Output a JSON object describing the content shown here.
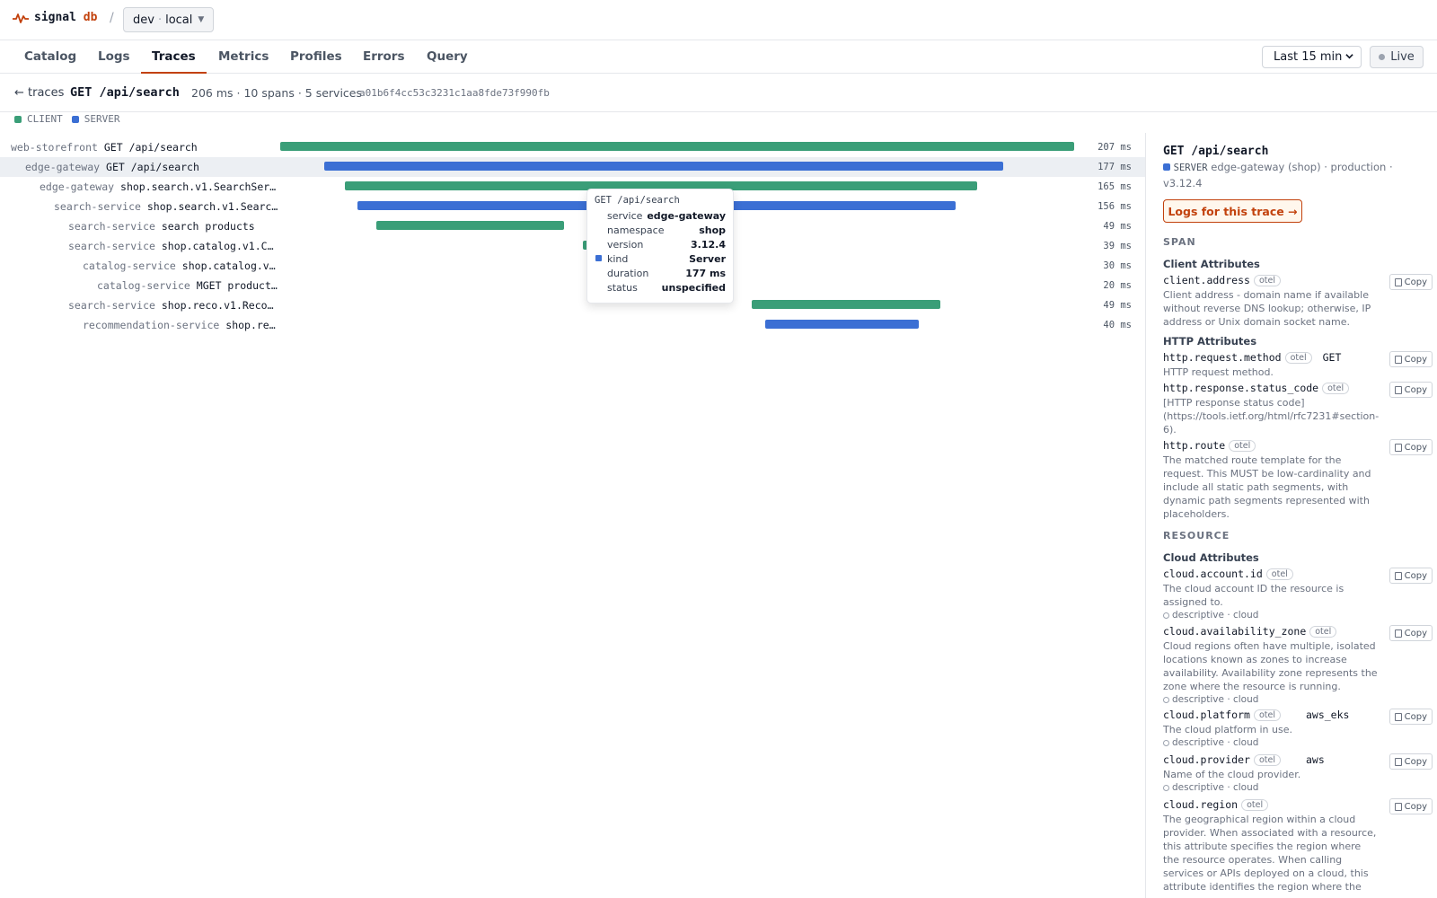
{
  "app": {
    "name": "signal",
    "name_accent": "db",
    "separator": "/",
    "env_name": "dev",
    "env_dot": "·",
    "env_location": "local"
  },
  "nav": {
    "tabs": [
      {
        "label": "Catalog"
      },
      {
        "label": "Logs"
      },
      {
        "label": "Traces",
        "active": true
      },
      {
        "label": "Metrics"
      },
      {
        "label": "Profiles"
      },
      {
        "label": "Errors"
      },
      {
        "label": "Query"
      }
    ],
    "time_range": "Last 15 min",
    "live_label": "Live"
  },
  "trace": {
    "back_label": "← traces",
    "title": "GET /api/search",
    "stats": "206 ms · 10 spans · 5 services",
    "trace_id": "a01b6f4cc53c3231c1aa8fde73f990fb"
  },
  "legend": [
    {
      "label": "CLIENT",
      "color": "#3a9e78"
    },
    {
      "label": "SERVER",
      "color": "#3b6fd4"
    }
  ],
  "spans": [
    {
      "service": "web-storefront",
      "operation": "GET /api/search",
      "duration": "207 ms",
      "kind": "client",
      "depth": 0,
      "start": 0,
      "end": 207
    },
    {
      "service": "edge-gateway",
      "operation": "GET /api/search",
      "duration": "177 ms",
      "kind": "server",
      "depth": 1,
      "start": 11.5,
      "end": 188.5,
      "selected": true
    },
    {
      "service": "edge-gateway",
      "operation": "shop.search.v1.SearchServi…",
      "duration": "165 ms",
      "kind": "client",
      "depth": 2,
      "start": 16.8,
      "end": 181.8
    },
    {
      "service": "search-service",
      "operation": "shop.search.v1.Search…",
      "duration": "156 ms",
      "kind": "server",
      "depth": 3,
      "start": 20.1,
      "end": 176.1
    },
    {
      "service": "search-service",
      "operation": "search products",
      "duration": "49 ms",
      "kind": "client",
      "depth": 4,
      "start": 25,
      "end": 74
    },
    {
      "service": "search-service",
      "operation": "shop.catalog.v1.Cat…",
      "duration": "39 ms",
      "kind": "client",
      "depth": 4,
      "start": 79,
      "end": 118
    },
    {
      "service": "catalog-service",
      "operation": "shop.catalog.v1.…",
      "duration": "30 ms",
      "kind": "server",
      "depth": 5,
      "start": 83,
      "end": 113
    },
    {
      "service": "catalog-service",
      "operation": "MGET product:…",
      "duration": "20 ms",
      "kind": "client",
      "depth": 6,
      "start": 88,
      "end": 108
    },
    {
      "service": "search-service",
      "operation": "shop.reco.v1.Recomm…",
      "duration": "49 ms",
      "kind": "client",
      "depth": 4,
      "start": 123,
      "end": 172
    },
    {
      "service": "recommendation-service",
      "operation": "shop.reco…",
      "duration": "40 ms",
      "kind": "server",
      "depth": 5,
      "start": 126.5,
      "end": 166.5
    }
  ],
  "tooltip": {
    "title": "GET /api/search",
    "rows": [
      {
        "key": "service",
        "value": "edge-gateway"
      },
      {
        "key": "namespace",
        "value": "shop"
      },
      {
        "key": "version",
        "value": "3.12.4"
      },
      {
        "key": "kind",
        "value": "Server",
        "swatch": true
      },
      {
        "key": "duration",
        "value": "177 ms"
      },
      {
        "key": "status",
        "value": "unspecified"
      }
    ]
  },
  "panel": {
    "title": "GET /api/search",
    "kind": "SERVER",
    "meta": "edge-gateway (shop) · production · v3.12.4",
    "logs_button": "Logs for this trace →",
    "span_section": "SPAN",
    "resource_section": "RESOURCE",
    "copy_label": "Copy",
    "otel_label": "otel",
    "groups": [
      {
        "title": "Client Attributes",
        "attrs": [
          {
            "name": "client.address",
            "value": "",
            "desc": "Client address - domain name if available without reverse DNS lookup; otherwise, IP address or Unix domain socket name."
          }
        ]
      },
      {
        "title": "HTTP Attributes",
        "attrs": [
          {
            "name": "http.request.method",
            "value": "GET",
            "desc": "HTTP request method."
          },
          {
            "name": "http.response.status_code",
            "value": "",
            "desc": "[HTTP response status code](https://tools.ietf.org/html/rfc7231#section-6)."
          },
          {
            "name": "http.route",
            "value": "",
            "desc": "The matched route template for the request. This MUST be low-cardinality and include all static path segments, with dynamic path segments represented with placeholders."
          }
        ]
      },
      {
        "title": "Cloud Attributes",
        "resource": true,
        "attrs": [
          {
            "name": "cloud.account.id",
            "value": "",
            "desc": "The cloud account ID the resource is assigned to.",
            "tag": "descriptive · cloud"
          },
          {
            "name": "cloud.availability_zone",
            "value": "",
            "desc": "Cloud regions often have multiple, isolated locations known as zones to increase availability. Availability zone represents the zone where the resource is running.",
            "tag": "descriptive · cloud"
          },
          {
            "name": "cloud.platform",
            "value": "aws_eks",
            "desc": "The cloud platform in use.",
            "tag": "descriptive · cloud"
          },
          {
            "name": "cloud.provider",
            "value": "aws",
            "desc": "Name of the cloud provider.",
            "tag": "descriptive · cloud"
          },
          {
            "name": "cloud.region",
            "value": "",
            "desc": "The geographical region within a cloud provider. When associated with a resource, this attribute specifies the region where the resource operates. When calling services or APIs deployed on a cloud, this attribute identifies the region where the",
            "tag": ""
          }
        ]
      }
    ]
  }
}
